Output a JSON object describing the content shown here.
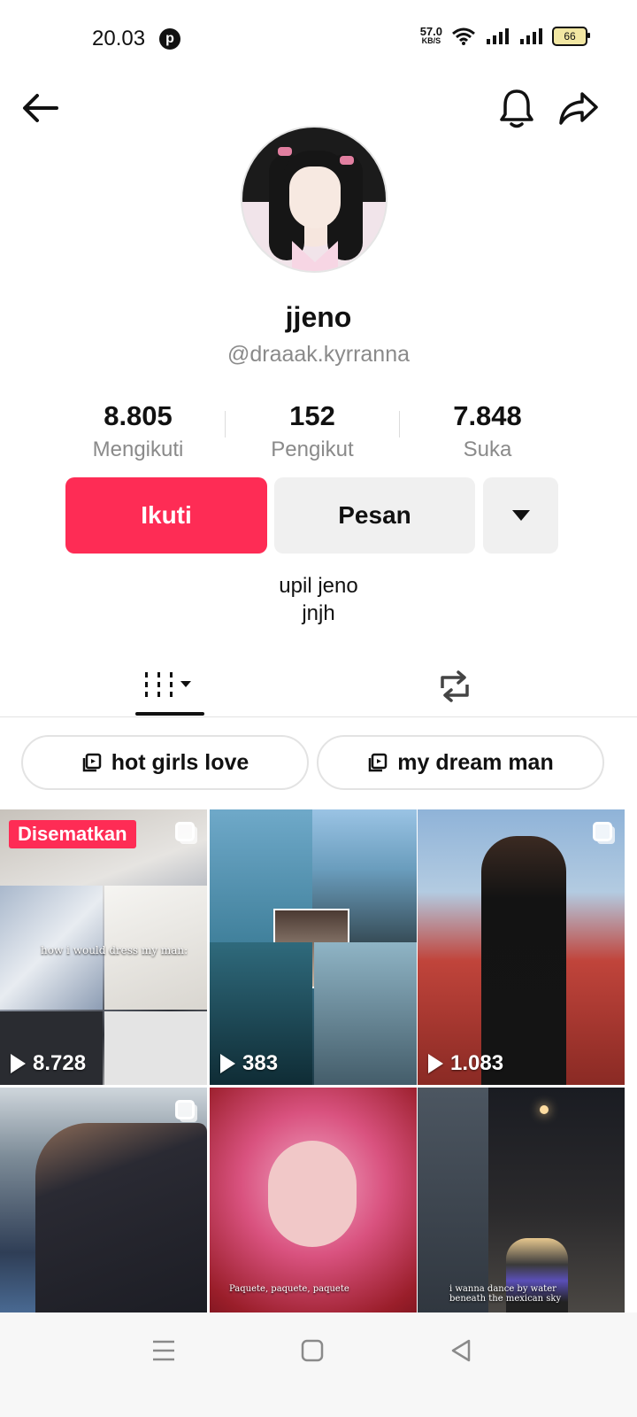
{
  "status_bar": {
    "time": "20.03",
    "speed_value": "57.0",
    "speed_unit": "KB/S",
    "battery": "66"
  },
  "header": {
    "back_icon": "arrow-left-icon",
    "bell_icon": "bell-icon",
    "share_icon": "share-arrow-icon"
  },
  "profile": {
    "name": "jjeno",
    "handle": "@draaak.kyrranna",
    "stats": [
      {
        "value": "8.805",
        "label": "Mengikuti"
      },
      {
        "value": "152",
        "label": "Pengikut"
      },
      {
        "value": "7.848",
        "label": "Suka"
      }
    ],
    "follow_label": "Ikuti",
    "message_label": "Pesan",
    "bio_lines": [
      "upil jeno",
      "jnjh"
    ]
  },
  "tabs": {
    "videos_icon": "grid-columns-icon",
    "reposts_icon": "repost-icon"
  },
  "playlists": [
    {
      "label": "hot girls love"
    },
    {
      "label": "my dream man"
    }
  ],
  "videos": [
    {
      "views": "8.728",
      "pinned_label": "Disematkan",
      "caption": "how i would dress my man:"
    },
    {
      "views": "383"
    },
    {
      "views": "1.083"
    },
    {
      "views": ""
    },
    {
      "views": "",
      "caption": "Paquete, paquete, paquete"
    },
    {
      "views": "",
      "caption": "i wanna dance by water beneath the mexican sky"
    }
  ],
  "accent_color": "#fe2c55"
}
